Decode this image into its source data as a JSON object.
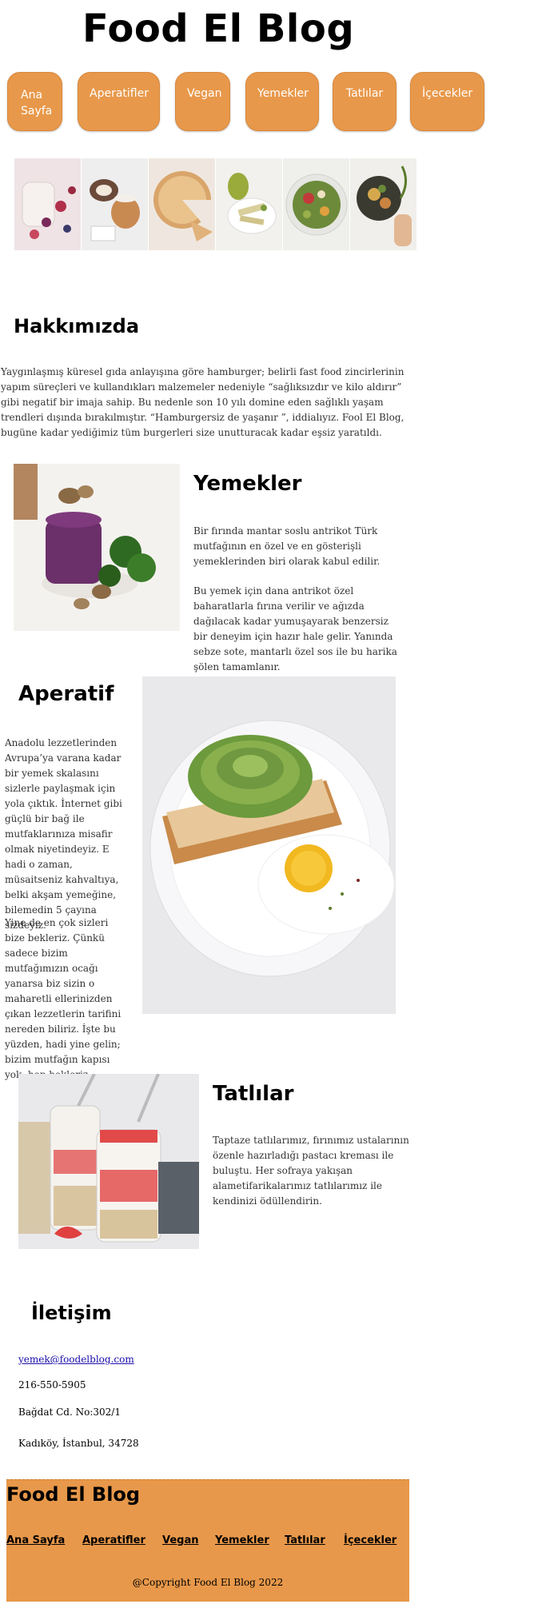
{
  "header": {
    "title": "Food El Blog"
  },
  "nav": {
    "items": [
      {
        "label": "Ana Sayfa"
      },
      {
        "label": "Aperatifler"
      },
      {
        "label": "Vegan"
      },
      {
        "label": "Yemekler"
      },
      {
        "label": "Tatlılar"
      },
      {
        "label": "İçecekler"
      }
    ]
  },
  "about": {
    "heading": "Hakkımızda",
    "text": "Yaygınlaşmış küresel gıda anlayışına göre hamburger; belirli fast food zincirlerinin yapım süreçleri ve kullandıkları malzemeler nedeniyle “sağlıksızdır ve kilo aldırır” gibi negatif bir imaja sahip. Bu nedenle son 10 yılı domine eden sağlıklı yaşam trendleri dışında bırakılmıştır. “Hamburgersiz de yaşanır ”, iddialıyız. Fool El Blog, bugüne kadar yediğimiz tüm burgerleri size unutturacak kadar eşsiz yaratıldı."
  },
  "yemekler": {
    "heading": "Yemekler",
    "p1": "Bir fırında mantar soslu antrikot Türk mutfağının en özel ve en gösterişli yemeklerinden biri olarak kabul edilir.",
    "p2": "Bu yemek için dana antrikot özel baharatlarla fırına verilir ve ağızda dağılacak kadar yumuşayarak benzersiz bir deneyim için hazır hale gelir. Yanında sebze sote, mantarlı özel sos ile bu harika şölen tamamlanır."
  },
  "aperatif": {
    "heading": "Aperatif",
    "p1": "Anadolu lezzetlerinden Avrupa’ya varana kadar bir yemek skalasını sizlerle paylaşmak için yola çıktık. İnternet gibi güçlü bir bağ ile mutfaklarınıza misafir olmak niyetindeyiz. E hadi o zaman, müsaitseniz kahvaltıya, belki akşam yemeğine, bilemedin 5 çayına sizdeyiz.",
    "p2": "Yine de en çok sizleri bize bekleriz. Çünkü sadece bizim mutfağımızın ocağı yanarsa biz sizin o maharetli ellerinizden çıkan lezzetlerin tarifini nereden biliriz. İşte bu yüzden, hadi yine gelin; bizim mutfağın kapısı yok, hep bekleriz."
  },
  "tatlilar": {
    "heading": "Tatlılar",
    "text": "Taptaze tatlılarımız, fırınımız ustalarının özenle hazırladığı pastacı kreması ile buluştu. Her sofraya yakışan alametifarikalarımız tatlılarımız ile kendinizi ödüllendirin."
  },
  "contact": {
    "heading": "İletişim",
    "email": "yemek@foodelblog.com",
    "phone": "216-550-5905",
    "address1": "Bağdat Cd. No:302/1",
    "address2": "Kadıköy, İstanbul, 34728"
  },
  "footer": {
    "title": "Food El Blog",
    "links": [
      {
        "label": "Ana Sayfa"
      },
      {
        "label": "Aperatifler"
      },
      {
        "label": "Vegan"
      },
      {
        "label": "Yemekler"
      },
      {
        "label": "Tatlılar"
      },
      {
        "label": "İçecekler"
      }
    ],
    "copyright": "@Copyright Food El Blog 2022"
  },
  "colors": {
    "accent": "#E8984A",
    "link": "#1a0dab",
    "text": "#333333"
  }
}
